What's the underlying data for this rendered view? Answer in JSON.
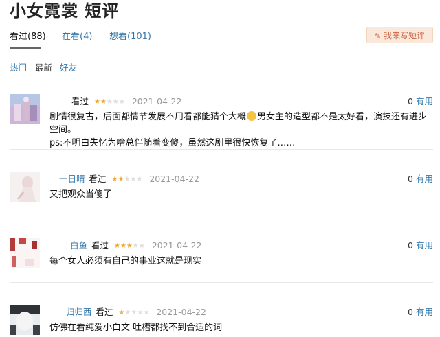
{
  "page": {
    "title": "小女霓裳 短评"
  },
  "tabs": [
    {
      "label": "看过(88)",
      "active": true
    },
    {
      "label": "在看(4)",
      "active": false
    },
    {
      "label": "想看(101)",
      "active": false
    }
  ],
  "write_button": {
    "label": "我来写短评",
    "icon": "pencil-icon"
  },
  "sort": {
    "hot": "热门",
    "latest": "最新",
    "friends": "好友"
  },
  "comments": [
    {
      "user": "",
      "status": "看过",
      "rating": 2,
      "date": "2021-04-22",
      "votes": "0",
      "useful_label": "有用",
      "text_before_emoji": "剧情很复古，后面都情节发展不用看都能猜个大概",
      "text_after_emoji": "男女主的造型都不是太好看，演技还有进步空间。",
      "text_line2": "ps:不明白失忆为啥总伴随着变傻，虽然这剧里很快恢复了……",
      "emoji": "grinning-face-emoji"
    },
    {
      "user": "一日晴",
      "status": "看过",
      "rating": 2,
      "date": "2021-04-22",
      "votes": "0",
      "useful_label": "有用",
      "text": "又把观众当傻子"
    },
    {
      "user": "白鱼",
      "status": "看过",
      "rating": 3,
      "date": "2021-04-22",
      "votes": "0",
      "useful_label": "有用",
      "text": "每个女人必须有自己的事业这就是现实"
    },
    {
      "user": "归归西",
      "status": "看过",
      "rating": 1,
      "date": "2021-04-22",
      "votes": "0",
      "useful_label": "有用",
      "text": "仿佛在看纯爱小白文 吐槽都找不到合适的词"
    }
  ],
  "colors": {
    "link": "#3377aa",
    "star": "#f5a623",
    "button_bg": "#fae9da",
    "button_text": "#ca6445"
  }
}
